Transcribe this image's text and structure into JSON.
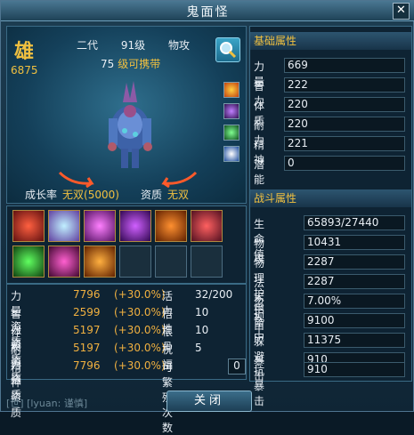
{
  "window": {
    "title": "鬼面怪",
    "close_icon": "close-icon"
  },
  "pet": {
    "gender": "雄",
    "score": "6875",
    "generation": "二代",
    "level": "91级",
    "attack_type": "物攻",
    "carry_level": "75",
    "carry_text": "级可携带",
    "growth_label": "成长率",
    "growth_value": "无双(5000)",
    "aptitude_label": "资质",
    "aptitude_value": "无双"
  },
  "aptitudes": [
    {
      "label": "力量资质",
      "value": "7796",
      "pct": "(+30.0%)",
      "label2": "活力",
      "value2": "32/200"
    },
    {
      "label": "智力资质",
      "value": "2599",
      "pct": "(+30.0%)",
      "label2": "悟性",
      "value2": "10"
    },
    {
      "label": "体质资质",
      "value": "5197",
      "pct": "(+30.0%)",
      "label2": "根骨",
      "value2": "10"
    },
    {
      "label": "耐力资质",
      "value": "5197",
      "pct": "(+30.0%)",
      "label2": "祝福",
      "value2": "5"
    },
    {
      "label": "精神资质",
      "value": "7796",
      "pct": "(+30.0%)",
      "label2": "可繁殖次数",
      "value2": "0"
    }
  ],
  "basic": {
    "header": "基础属性",
    "rows": [
      {
        "label": "力量",
        "value": "669"
      },
      {
        "label": "智力",
        "value": "222"
      },
      {
        "label": "体质",
        "value": "220"
      },
      {
        "label": "耐力",
        "value": "220"
      },
      {
        "label": "精神",
        "value": "221"
      },
      {
        "label": "潜能",
        "value": "0"
      }
    ]
  },
  "combat": {
    "header": "战斗属性",
    "rows": [
      {
        "label": "生命值",
        "value": "65893/27440"
      },
      {
        "label": "物攻",
        "value": "10431"
      },
      {
        "label": "物理护甲",
        "value": "2287"
      },
      {
        "label": "法术护甲",
        "value": "2287"
      },
      {
        "label": "忽视",
        "value": "7.00%"
      },
      {
        "label": "命中",
        "value": "9100"
      },
      {
        "label": "躲避",
        "value": "11375"
      },
      {
        "label": "暴击",
        "value": "910"
      },
      {
        "label": "抗暴击",
        "value": "910"
      }
    ]
  },
  "close_button": "关闭",
  "chat_snippet": "[世] [lyuan: 谨慎]",
  "colors": {
    "gold": "#f0c040",
    "accent": "#f0b040",
    "panel": "#0e2333"
  }
}
